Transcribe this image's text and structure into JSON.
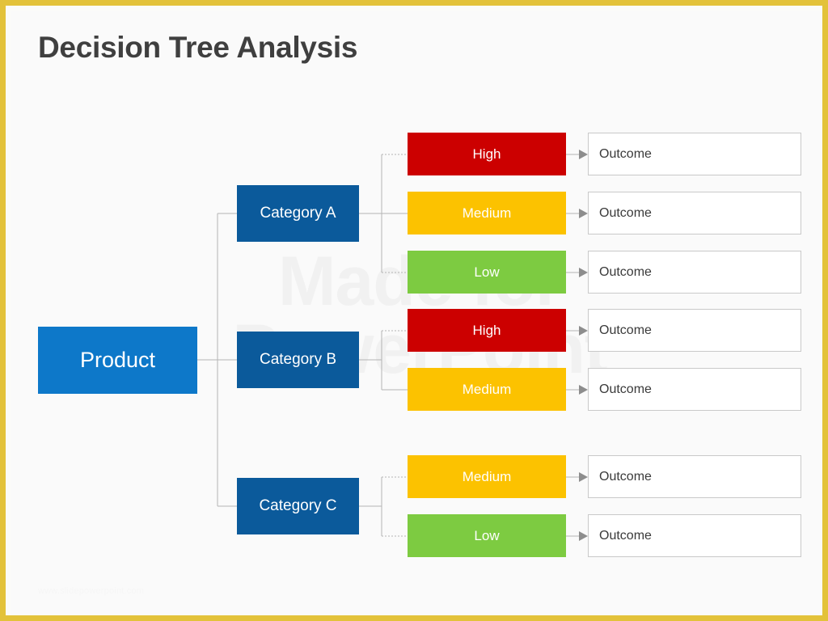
{
  "slide": {
    "title": "Decision Tree Analysis",
    "border_color": "#e3c23a",
    "background_color": "#fafafa",
    "watermark_line1": "Made for",
    "watermark_line2": "PowerPoint",
    "footer_watermark": "www.slidepowerpoint.com"
  },
  "palette": {
    "root_blue": "#0d78c9",
    "category_blue": "#0b5a9b",
    "high_red": "#cc0000",
    "medium_yellow": "#fcc200",
    "low_green": "#7dcb41",
    "outcome_border": "#c9c9c9",
    "connector": "#b4b4b4",
    "title_text": "#3f3f3f"
  },
  "root": {
    "label": "Product"
  },
  "categories": [
    {
      "label": "Category A"
    },
    {
      "label": "Category B"
    },
    {
      "label": "Category C"
    }
  ],
  "levels": [
    {
      "label": "High",
      "color": "#cc0000",
      "category": "Category A"
    },
    {
      "label": "Medium",
      "color": "#fcc200",
      "category": "Category A"
    },
    {
      "label": "Low",
      "color": "#7dcb41",
      "category": "Category A"
    },
    {
      "label": "High",
      "color": "#cc0000",
      "category": "Category B"
    },
    {
      "label": "Medium",
      "color": "#fcc200",
      "category": "Category B"
    },
    {
      "label": "Medium",
      "color": "#fcc200",
      "category": "Category C"
    },
    {
      "label": "Low",
      "color": "#7dcb41",
      "category": "Category C"
    }
  ],
  "outcomes": [
    {
      "label": "Outcome"
    },
    {
      "label": "Outcome"
    },
    {
      "label": "Outcome"
    },
    {
      "label": "Outcome"
    },
    {
      "label": "Outcome"
    },
    {
      "label": "Outcome"
    },
    {
      "label": "Outcome"
    }
  ]
}
